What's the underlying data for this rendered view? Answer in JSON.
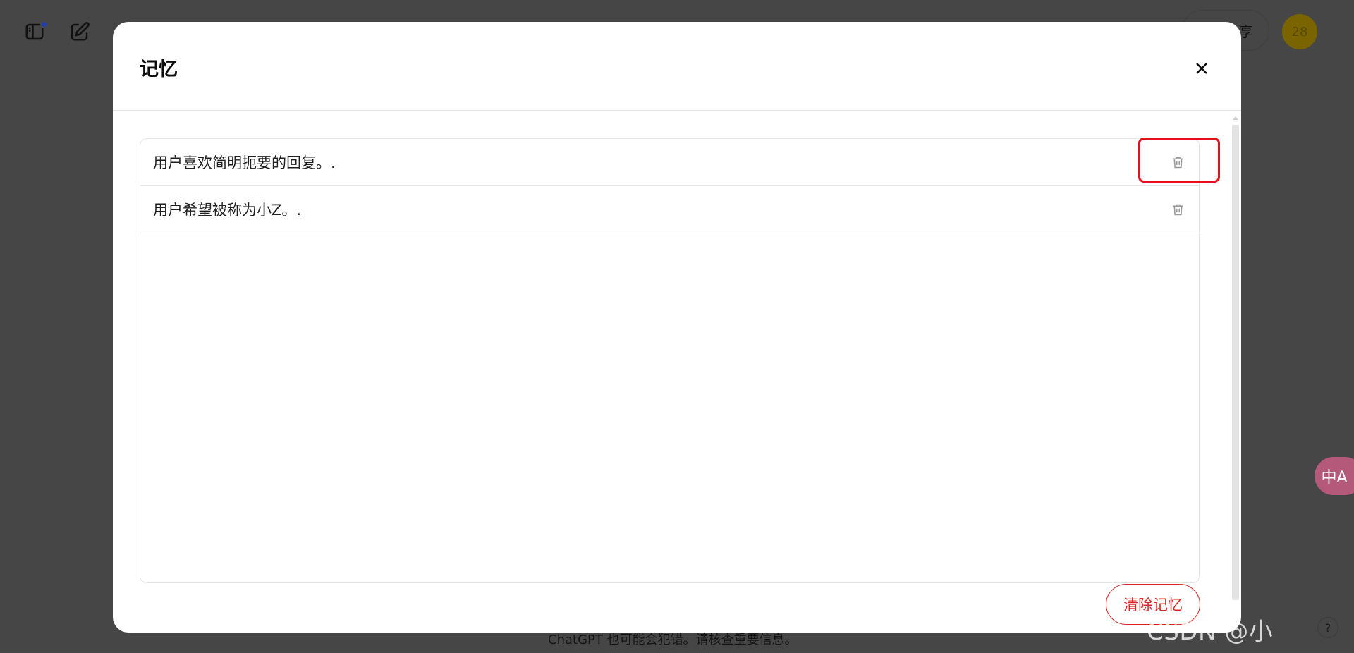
{
  "background": {
    "share_label": "享",
    "avatar_text": "28",
    "footer_note": "ChatGPT 也可能会犯错。请核查重要信息。",
    "help_label": "?",
    "translate_label": "中A"
  },
  "modal": {
    "title": "记忆",
    "memories": [
      {
        "text": "用户喜欢简明扼要的回复。."
      },
      {
        "text": "用户希望被称为小Z。."
      }
    ],
    "clear_button_label": "清除记忆"
  },
  "watermark": "CSDN @小",
  "colors": {
    "danger": "#dc2626",
    "highlight": "#e1121c",
    "overlay": "#464646"
  },
  "icons": {
    "close": "close-icon",
    "delete": "trash-icon",
    "sidebar": "sidebar-toggle-icon",
    "new_chat": "edit-icon"
  }
}
